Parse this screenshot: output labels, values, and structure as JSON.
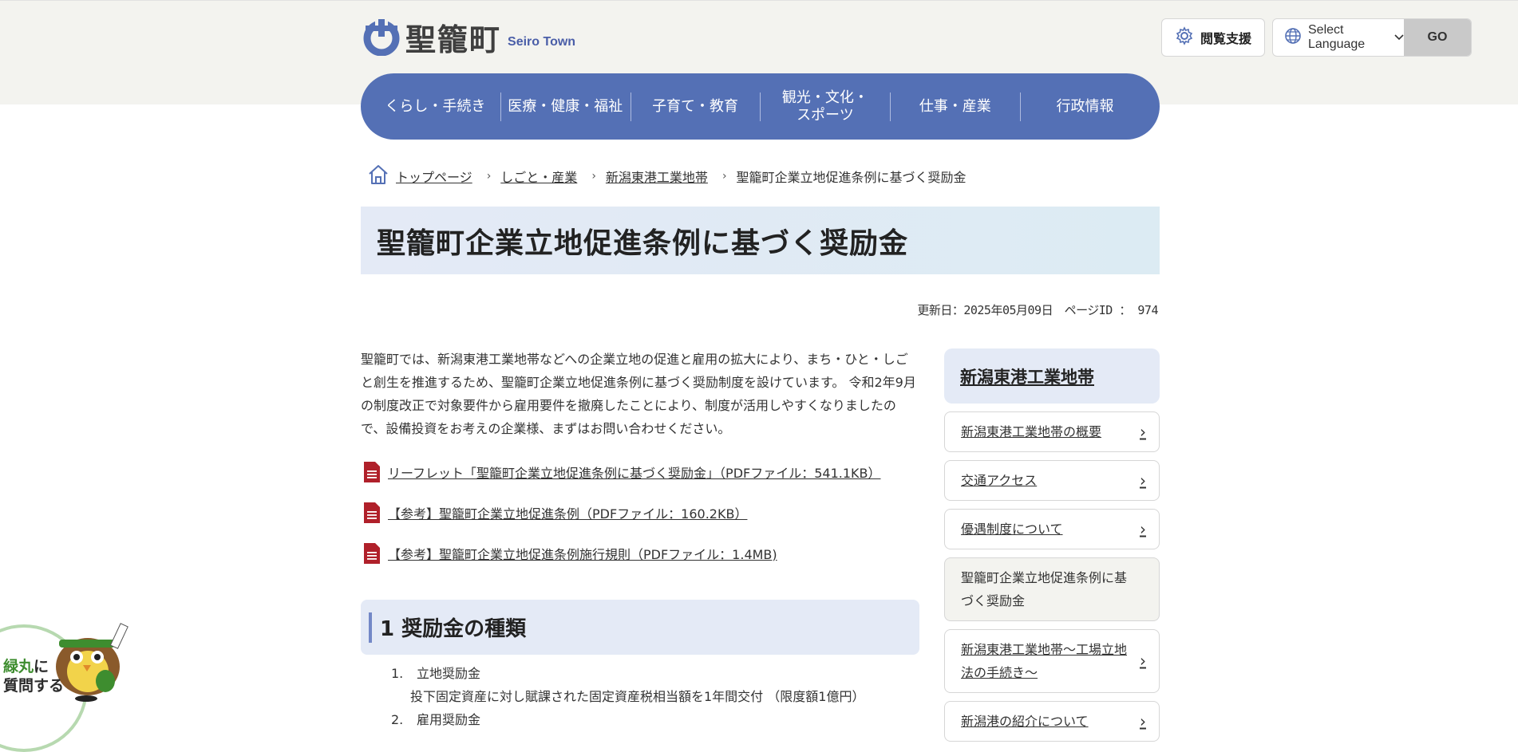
{
  "header": {
    "logo_jp": "聖籠町",
    "logo_en": "Seiro Town",
    "assist_label": "閲覧支援",
    "lang_label": "Select Language",
    "go_label": "GO"
  },
  "nav": [
    "くらし・手続き",
    "医療・健康・福祉",
    "子育て・教育",
    "観光・文化・\nスポーツ",
    "仕事・産業",
    "行政情報"
  ],
  "breadcrumb": {
    "home": "トップページ",
    "items": [
      "しごと・産業",
      "新潟東港工業地帯"
    ],
    "current": "聖籠町企業立地促進条例に基づく奨励金"
  },
  "page": {
    "title": "聖籠町企業立地促進条例に基づく奨励金",
    "meta": "更新日：2025年05月09日　ページID ： 974",
    "intro": "聖籠町では、新潟東港工業地帯などへの企業立地の促進と雇用の拡大により、まち・ひと・しごと創生を推進するため、聖籠町企業立地促進条例に基づく奨励制度を設けています。 令和2年9月の制度改正で対象要件から雇用要件を撤廃したことにより、制度が活用しやすくなりましたので、設備投資をお考えの企業様、まずはお問い合わせください。",
    "pdfs": [
      "リーフレット「聖籠町企業立地促進条例に基づく奨励金」（PDFファイル：541.1KB）",
      "【参考】聖籠町企業立地促進条例（PDFファイル：160.2KB）",
      "【参考】聖籠町企業立地促進条例施行規則（PDFファイル：1.4MB)"
    ],
    "section_heading": "1  奨励金の種類",
    "list": [
      {
        "num": "1.",
        "label": "立地奨励金",
        "desc": "投下固定資産に対し賦課された固定資産税相当額を1年間交付 （限度額1億円）"
      },
      {
        "num": "2.",
        "label": "雇用奨励金",
        "desc": ""
      }
    ]
  },
  "sidebar": {
    "heading": "新潟東港工業地帯",
    "items": [
      "新潟東港工業地帯の概要",
      "交通アクセス",
      "優遇制度について",
      "聖籠町企業立地促進条例に基づく奨励金",
      "新潟東港工業地帯～工場立地法の手続き～",
      "新潟港の紹介について"
    ]
  },
  "mascot": {
    "line1_green": "緑丸",
    "line1_rest": "に",
    "line2": "質問する"
  },
  "colors": {
    "nav_blue": "#5470b5",
    "title_bg": "#e4eaf6",
    "pdf_red": "#b0202a"
  }
}
